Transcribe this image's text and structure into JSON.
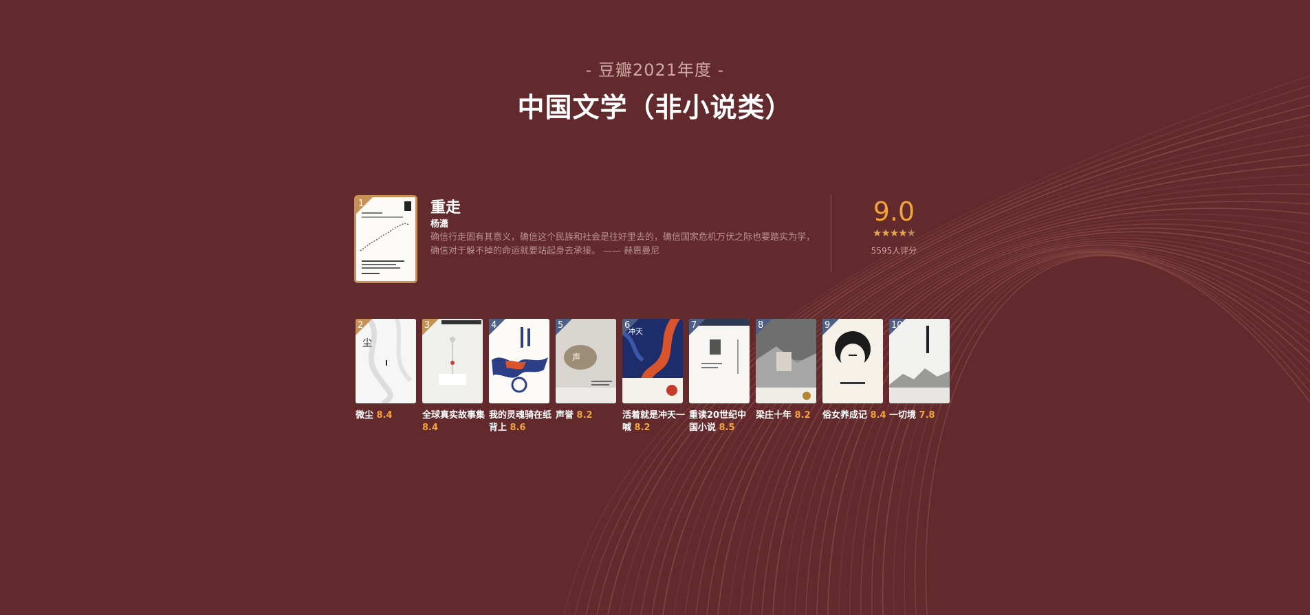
{
  "header": {
    "subtitle": "- 豆瓣2021年度 -",
    "title": "中国文学（非小说类）"
  },
  "colors": {
    "background": "#622a2d",
    "score": "#f2a33a",
    "badge_gold": "#c79055",
    "badge_blue": "#4e5f86"
  },
  "featured": {
    "rank": "1",
    "title": "重走",
    "author": "杨潇",
    "quote": "确信行走固有其意义，确信这个民族和社会是往好里去的，确信国家危机万伏之际也要踏实为学，确信对于躲不掉的命运就要站起身去承接。 —— 赫恩曼尼",
    "score": "9.0",
    "stars": 4.5,
    "rating_count": "5595人评分",
    "icons": [
      "star-icon"
    ]
  },
  "books": [
    {
      "rank": "2",
      "title": "微尘",
      "score": "8.4",
      "badge": "gold"
    },
    {
      "rank": "3",
      "title": "全球真实故事集",
      "score": "8.4",
      "badge": "gold"
    },
    {
      "rank": "4",
      "title": "我的灵魂骑在纸背上",
      "score": "8.6",
      "badge": "blue"
    },
    {
      "rank": "5",
      "title": "声誉",
      "score": "8.2",
      "badge": "blue"
    },
    {
      "rank": "6",
      "title": "活着就是冲天一喊",
      "score": "8.2",
      "badge": "blue"
    },
    {
      "rank": "7",
      "title": "重读20世纪中国小说",
      "score": "8.5",
      "badge": "blue"
    },
    {
      "rank": "8",
      "title": "梁庄十年",
      "score": "8.2",
      "badge": "blue"
    },
    {
      "rank": "9",
      "title": "俗女养成记",
      "score": "8.4",
      "badge": "blue"
    },
    {
      "rank": "10",
      "title": "一切境",
      "score": "7.8",
      "badge": "blue"
    }
  ]
}
